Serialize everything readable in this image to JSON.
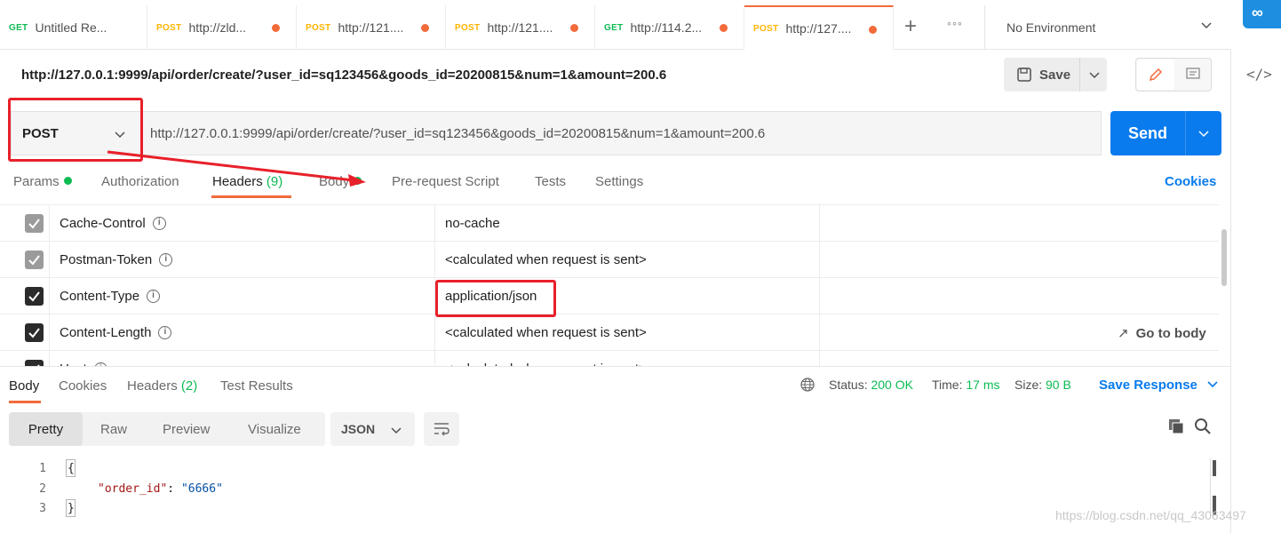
{
  "tabs": [
    {
      "method": "GET",
      "label": "Untitled Re...",
      "dirty": false
    },
    {
      "method": "POST",
      "label": "http://zld...",
      "dirty": true
    },
    {
      "method": "POST",
      "label": "http://121....",
      "dirty": true
    },
    {
      "method": "POST",
      "label": "http://121....",
      "dirty": true
    },
    {
      "method": "GET",
      "label": "http://114.2...",
      "dirty": true
    },
    {
      "method": "POST",
      "label": "http://127....",
      "dirty": true,
      "active": true
    }
  ],
  "tabbar": {
    "new_tab": "+",
    "more": "ooo",
    "environment": "No Environment"
  },
  "request": {
    "title": "http://127.0.0.1:9999/api/order/create/?user_id=sq123456&goods_id=20200815&num=1&amount=200.6",
    "method": "POST",
    "url": "http://127.0.0.1:9999/api/order/create/?user_id=sq123456&goods_id=20200815&num=1&amount=200.6",
    "save_label": "Save",
    "send_label": "Send"
  },
  "request_tabs": {
    "params": "Params",
    "authorization": "Authorization",
    "headers": "Headers",
    "headers_count": "(9)",
    "body": "Body",
    "pre_request": "Pre-request Script",
    "tests": "Tests",
    "settings": "Settings",
    "cookies": "Cookies"
  },
  "headers": [
    {
      "key": "Cache-Control",
      "value": "no-cache",
      "checked": true,
      "disabled": true
    },
    {
      "key": "Postman-Token",
      "value": "<calculated when request is sent>",
      "checked": true,
      "disabled": true
    },
    {
      "key": "Content-Type",
      "value": "application/json",
      "checked": true,
      "disabled": false
    },
    {
      "key": "Content-Length",
      "value": "<calculated when request is sent>",
      "checked": true,
      "disabled": false
    },
    {
      "key": "Host",
      "value": "<calculated when request is sent>",
      "checked": true,
      "disabled": false
    }
  ],
  "go_to_body": "Go to body",
  "response": {
    "tabs": {
      "body": "Body",
      "cookies": "Cookies",
      "headers": "Headers",
      "headers_count": "(2)",
      "test_results": "Test Results"
    },
    "status_label": "Status:",
    "status_value": "200 OK",
    "time_label": "Time:",
    "time_value": "17 ms",
    "size_label": "Size:",
    "size_value": "90 B",
    "save_response": "Save Response",
    "views": {
      "pretty": "Pretty",
      "raw": "Raw",
      "preview": "Preview",
      "visualize": "Visualize"
    },
    "format": "JSON",
    "lines": [
      {
        "num": "1",
        "open": "{"
      },
      {
        "num": "2",
        "key": "\"order_id\"",
        "sep": ": ",
        "value": "\"6666\""
      },
      {
        "num": "3",
        "close": "}"
      }
    ]
  },
  "watermark": "https://blog.csdn.net/qq_43063497",
  "colors": {
    "accent": "#f26b3a",
    "send": "#097bed",
    "highlight": "#e8202a",
    "ok": "#0cbb52"
  }
}
